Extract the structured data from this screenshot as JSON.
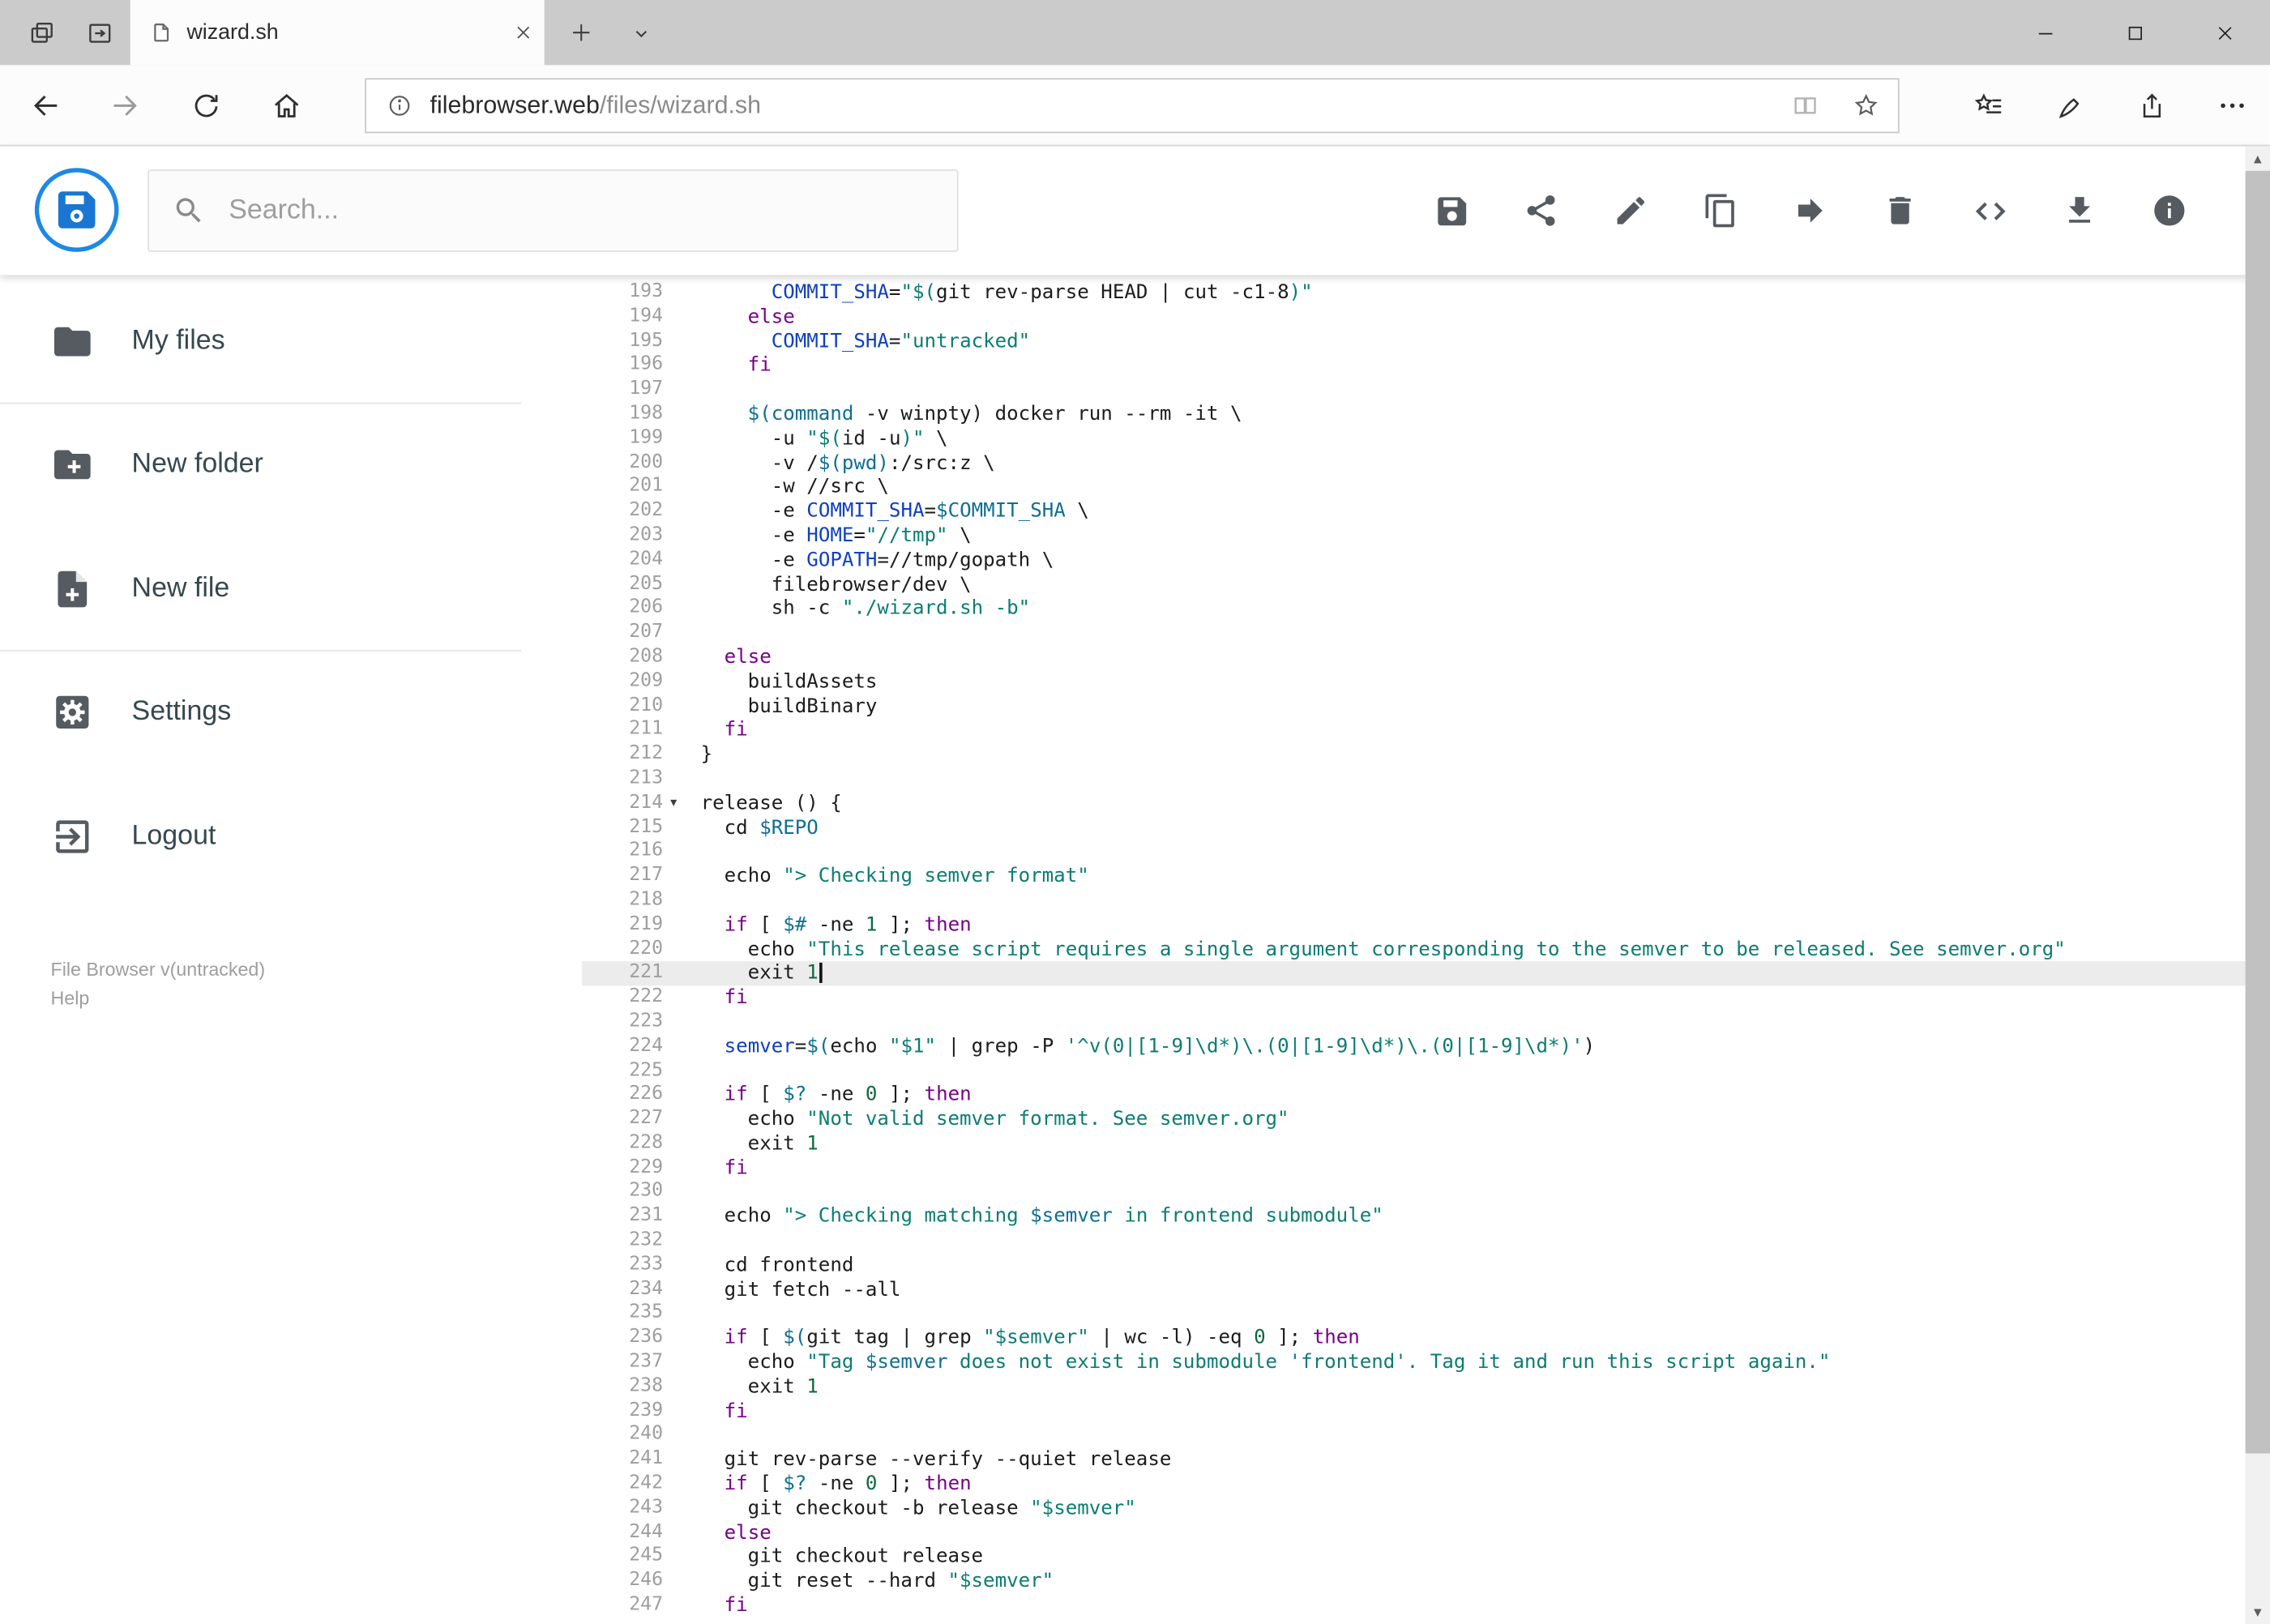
{
  "browser": {
    "tab_bar": {
      "active_tab": {
        "title": "wizard.sh"
      }
    },
    "nav_bar": {
      "url": {
        "host": "filebrowser.web",
        "path": "/files/wizard.sh"
      }
    }
  },
  "app": {
    "header": {
      "search_placeholder": "Search...",
      "toolbar_icons": [
        "save",
        "share",
        "edit",
        "copy",
        "move",
        "delete",
        "raw-code",
        "download",
        "info"
      ]
    },
    "sidebar": {
      "items": [
        {
          "label": "My files",
          "icon": "folder-icon"
        },
        {
          "label": "New folder",
          "icon": "new-folder-icon"
        },
        {
          "label": "New file",
          "icon": "new-file-icon"
        },
        {
          "label": "Settings",
          "icon": "settings-icon"
        },
        {
          "label": "Logout",
          "icon": "logout-icon"
        }
      ],
      "footer": {
        "version": "File Browser v(untracked)",
        "help": "Help"
      }
    }
  },
  "theme": {
    "accent": "#1e88e5",
    "logo_blue": "#1976d2",
    "tab_bar_bg": "#cbcbcb",
    "toolbar_icon_gray": "#555b60",
    "active_line_bg": "#ececec",
    "line_number_gray": "#9e9e9e"
  },
  "editor": {
    "language": "shell",
    "active_line": 221,
    "cursor": {
      "line": 221,
      "col": 10
    },
    "fold_markers": [
      214
    ],
    "syntax_colors": {
      "kw": "#770088",
      "def": "#1040c0",
      "var": "#0f6f93",
      "str": "#0c7d72",
      "num": "#116644",
      "plain": "#1c1c1c"
    },
    "lines": [
      {
        "n": 193,
        "segs": [
          [
            "      ",
            ""
          ],
          [
            "COMMIT_SHA",
            "def"
          ],
          [
            "=",
            ""
          ],
          [
            "\"$(",
            "str"
          ],
          [
            "git rev-parse HEAD | cut -c1-8",
            ""
          ],
          [
            ")\"",
            "str"
          ]
        ]
      },
      {
        "n": 194,
        "segs": [
          [
            "    ",
            ""
          ],
          [
            "else",
            "kw"
          ]
        ]
      },
      {
        "n": 195,
        "segs": [
          [
            "      ",
            ""
          ],
          [
            "COMMIT_SHA",
            "def"
          ],
          [
            "=",
            ""
          ],
          [
            "\"untracked\"",
            "str"
          ]
        ]
      },
      {
        "n": 196,
        "segs": [
          [
            "    ",
            ""
          ],
          [
            "fi",
            "kw"
          ]
        ]
      },
      {
        "n": 197,
        "segs": []
      },
      {
        "n": 198,
        "segs": [
          [
            "    ",
            ""
          ],
          [
            "$(command",
            "var"
          ],
          [
            " -v winpty) docker run --rm -it \\",
            ""
          ]
        ]
      },
      {
        "n": 199,
        "segs": [
          [
            "      ",
            ""
          ],
          [
            "-u ",
            ""
          ],
          [
            "\"$(",
            "str"
          ],
          [
            "id -u",
            ""
          ],
          [
            ")\"",
            "str"
          ],
          [
            " \\",
            ""
          ]
        ]
      },
      {
        "n": 200,
        "segs": [
          [
            "      ",
            ""
          ],
          [
            "-v /",
            ""
          ],
          [
            "$(pwd)",
            "var"
          ],
          [
            ":/src:z \\",
            ""
          ]
        ]
      },
      {
        "n": 201,
        "segs": [
          [
            "      ",
            ""
          ],
          [
            "-w //src \\",
            ""
          ]
        ]
      },
      {
        "n": 202,
        "segs": [
          [
            "      ",
            ""
          ],
          [
            "-e ",
            ""
          ],
          [
            "COMMIT_SHA",
            "def"
          ],
          [
            "=",
            ""
          ],
          [
            "$COMMIT_SHA",
            "var"
          ],
          [
            " \\",
            ""
          ]
        ]
      },
      {
        "n": 203,
        "segs": [
          [
            "      ",
            ""
          ],
          [
            "-e ",
            ""
          ],
          [
            "HOME",
            "def"
          ],
          [
            "=",
            ""
          ],
          [
            "\"//tmp\"",
            "str"
          ],
          [
            " \\",
            ""
          ]
        ]
      },
      {
        "n": 204,
        "segs": [
          [
            "      ",
            ""
          ],
          [
            "-e ",
            ""
          ],
          [
            "GOPATH",
            "def"
          ],
          [
            "=//tmp/gopath \\",
            ""
          ]
        ]
      },
      {
        "n": 205,
        "segs": [
          [
            "      ",
            ""
          ],
          [
            "filebrowser/dev \\",
            ""
          ]
        ]
      },
      {
        "n": 206,
        "segs": [
          [
            "      ",
            ""
          ],
          [
            "sh -c ",
            ""
          ],
          [
            "\"./wizard.sh -b\"",
            "str"
          ]
        ]
      },
      {
        "n": 207,
        "segs": []
      },
      {
        "n": 208,
        "segs": [
          [
            "  ",
            ""
          ],
          [
            "else",
            "kw"
          ]
        ]
      },
      {
        "n": 209,
        "segs": [
          [
            "    ",
            ""
          ],
          [
            "buildAssets",
            ""
          ]
        ]
      },
      {
        "n": 210,
        "segs": [
          [
            "    ",
            ""
          ],
          [
            "buildBinary",
            ""
          ]
        ]
      },
      {
        "n": 211,
        "segs": [
          [
            "  ",
            ""
          ],
          [
            "fi",
            "kw"
          ]
        ]
      },
      {
        "n": 212,
        "segs": [
          [
            "}",
            ""
          ]
        ]
      },
      {
        "n": 213,
        "segs": []
      },
      {
        "n": 214,
        "segs": [
          [
            "release () {",
            ""
          ]
        ]
      },
      {
        "n": 215,
        "segs": [
          [
            "  ",
            ""
          ],
          [
            "cd ",
            ""
          ],
          [
            "$REPO",
            "var"
          ]
        ]
      },
      {
        "n": 216,
        "segs": []
      },
      {
        "n": 217,
        "segs": [
          [
            "  ",
            ""
          ],
          [
            "echo ",
            ""
          ],
          [
            "\"> Checking semver format\"",
            "str"
          ]
        ]
      },
      {
        "n": 218,
        "segs": []
      },
      {
        "n": 219,
        "segs": [
          [
            "  ",
            ""
          ],
          [
            "if",
            "kw"
          ],
          [
            " [ ",
            ""
          ],
          [
            "$#",
            "var"
          ],
          [
            " -ne ",
            ""
          ],
          [
            "1",
            "num"
          ],
          [
            " ]; ",
            ""
          ],
          [
            "then",
            "kw"
          ]
        ]
      },
      {
        "n": 220,
        "segs": [
          [
            "    ",
            ""
          ],
          [
            "echo ",
            ""
          ],
          [
            "\"This release script requires a single argument corresponding to the semver to be released. See semver.org\"",
            "str"
          ]
        ]
      },
      {
        "n": 221,
        "segs": [
          [
            "    ",
            ""
          ],
          [
            "exit ",
            ""
          ],
          [
            "1",
            "num"
          ]
        ]
      },
      {
        "n": 222,
        "segs": [
          [
            "  ",
            ""
          ],
          [
            "fi",
            "kw"
          ]
        ]
      },
      {
        "n": 223,
        "segs": []
      },
      {
        "n": 224,
        "segs": [
          [
            "  ",
            ""
          ],
          [
            "semver",
            "def"
          ],
          [
            "=",
            ""
          ],
          [
            "$(",
            "var"
          ],
          [
            "echo ",
            ""
          ],
          [
            "\"$1\"",
            "str"
          ],
          [
            " | grep -P ",
            ""
          ],
          [
            "'^v(0|[1-9]\\d*)\\.(0|[1-9]\\d*)\\.(0|[1-9]\\d*)'",
            "str"
          ],
          [
            ")",
            ""
          ]
        ]
      },
      {
        "n": 225,
        "segs": []
      },
      {
        "n": 226,
        "segs": [
          [
            "  ",
            ""
          ],
          [
            "if",
            "kw"
          ],
          [
            " [ ",
            ""
          ],
          [
            "$?",
            "var"
          ],
          [
            " -ne ",
            ""
          ],
          [
            "0",
            "num"
          ],
          [
            " ]; ",
            ""
          ],
          [
            "then",
            "kw"
          ]
        ]
      },
      {
        "n": 227,
        "segs": [
          [
            "    ",
            ""
          ],
          [
            "echo ",
            ""
          ],
          [
            "\"Not valid semver format. See semver.org\"",
            "str"
          ]
        ]
      },
      {
        "n": 228,
        "segs": [
          [
            "    ",
            ""
          ],
          [
            "exit ",
            ""
          ],
          [
            "1",
            "num"
          ]
        ]
      },
      {
        "n": 229,
        "segs": [
          [
            "  ",
            ""
          ],
          [
            "fi",
            "kw"
          ]
        ]
      },
      {
        "n": 230,
        "segs": []
      },
      {
        "n": 231,
        "segs": [
          [
            "  ",
            ""
          ],
          [
            "echo ",
            ""
          ],
          [
            "\"> Checking matching ",
            "str"
          ],
          [
            "$semver",
            "var"
          ],
          [
            " in frontend submodule\"",
            "str"
          ]
        ]
      },
      {
        "n": 232,
        "segs": []
      },
      {
        "n": 233,
        "segs": [
          [
            "  ",
            ""
          ],
          [
            "cd frontend",
            ""
          ]
        ]
      },
      {
        "n": 234,
        "segs": [
          [
            "  ",
            ""
          ],
          [
            "git fetch --all",
            ""
          ]
        ]
      },
      {
        "n": 235,
        "segs": []
      },
      {
        "n": 236,
        "segs": [
          [
            "  ",
            ""
          ],
          [
            "if",
            "kw"
          ],
          [
            " [ ",
            ""
          ],
          [
            "$(",
            "var"
          ],
          [
            "git tag | grep ",
            ""
          ],
          [
            "\"$semver\"",
            "str"
          ],
          [
            " | wc -l) ",
            ""
          ],
          [
            "-eq ",
            ""
          ],
          [
            "0",
            "num"
          ],
          [
            " ]; ",
            ""
          ],
          [
            "then",
            "kw"
          ]
        ]
      },
      {
        "n": 237,
        "segs": [
          [
            "    ",
            ""
          ],
          [
            "echo ",
            ""
          ],
          [
            "\"Tag ",
            "str"
          ],
          [
            "$semver",
            "var"
          ],
          [
            " does not exist in submodule 'frontend'. Tag it and run this script again.\"",
            "str"
          ]
        ]
      },
      {
        "n": 238,
        "segs": [
          [
            "    ",
            ""
          ],
          [
            "exit ",
            ""
          ],
          [
            "1",
            "num"
          ]
        ]
      },
      {
        "n": 239,
        "segs": [
          [
            "  ",
            ""
          ],
          [
            "fi",
            "kw"
          ]
        ]
      },
      {
        "n": 240,
        "segs": []
      },
      {
        "n": 241,
        "segs": [
          [
            "  ",
            ""
          ],
          [
            "git rev-parse --verify --quiet release",
            ""
          ]
        ]
      },
      {
        "n": 242,
        "segs": [
          [
            "  ",
            ""
          ],
          [
            "if",
            "kw"
          ],
          [
            " [ ",
            ""
          ],
          [
            "$?",
            "var"
          ],
          [
            " -ne ",
            ""
          ],
          [
            "0",
            "num"
          ],
          [
            " ]; ",
            ""
          ],
          [
            "then",
            "kw"
          ]
        ]
      },
      {
        "n": 243,
        "segs": [
          [
            "    ",
            ""
          ],
          [
            "git checkout -b release ",
            ""
          ],
          [
            "\"$semver\"",
            "str"
          ]
        ]
      },
      {
        "n": 244,
        "segs": [
          [
            "  ",
            ""
          ],
          [
            "else",
            "kw"
          ]
        ]
      },
      {
        "n": 245,
        "segs": [
          [
            "    ",
            ""
          ],
          [
            "git checkout release",
            ""
          ]
        ]
      },
      {
        "n": 246,
        "segs": [
          [
            "    ",
            ""
          ],
          [
            "git reset --hard ",
            ""
          ],
          [
            "\"$semver\"",
            "str"
          ]
        ]
      },
      {
        "n": 247,
        "segs": [
          [
            "  ",
            ""
          ],
          [
            "fi",
            "kw"
          ]
        ]
      }
    ]
  }
}
